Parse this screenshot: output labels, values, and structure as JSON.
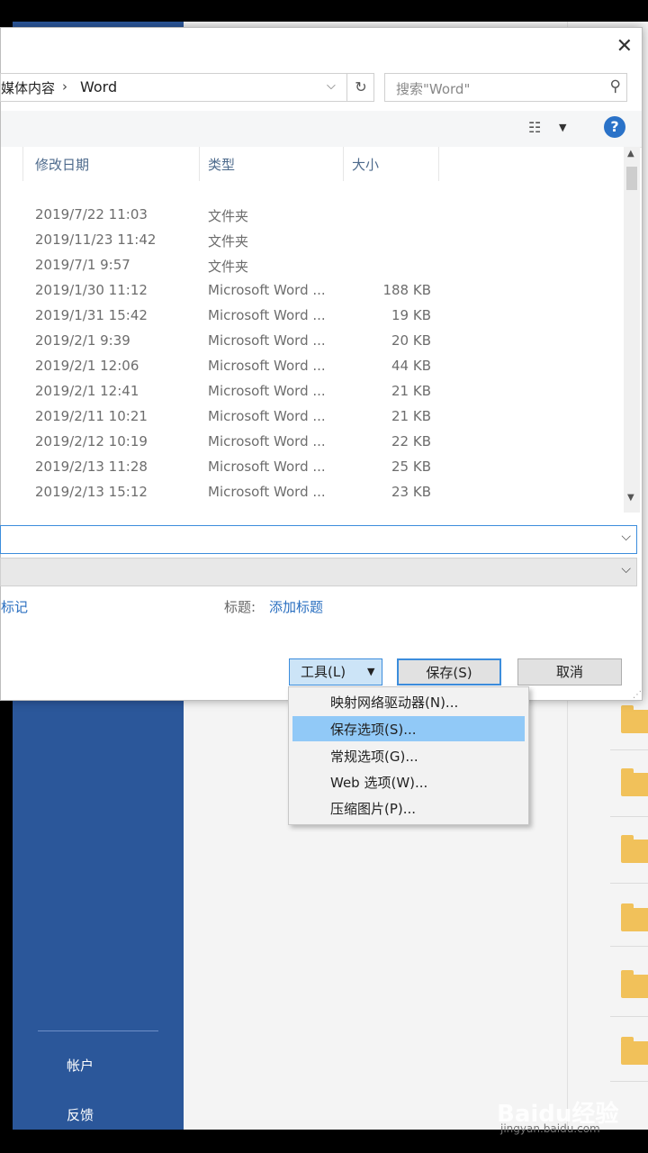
{
  "background_app": {
    "nav_account": "帐户",
    "nav_feedback": "反馈",
    "colors": {
      "backstage_blue": "#2b579a",
      "folder_yellow": "#f1c15a"
    }
  },
  "dialog": {
    "address": {
      "path_prefix": "媒体内容",
      "separator": "›",
      "current_folder": "Word"
    },
    "search": {
      "placeholder": "搜索\"Word\""
    },
    "columns": {
      "date": "修改日期",
      "type": "类型",
      "size": "大小"
    },
    "rows": [
      {
        "date": "2019/7/22 11:03",
        "type": "文件夹",
        "size": ""
      },
      {
        "date": "2019/11/23 11:42",
        "type": "文件夹",
        "size": ""
      },
      {
        "date": "2019/7/1 9:57",
        "type": "文件夹",
        "size": ""
      },
      {
        "date": "2019/1/30 11:12",
        "type": "Microsoft Word ...",
        "size": "188 KB"
      },
      {
        "date": "2019/1/31 15:42",
        "type": "Microsoft Word ...",
        "size": "19 KB"
      },
      {
        "date": "2019/2/1 9:39",
        "type": "Microsoft Word ...",
        "size": "20 KB"
      },
      {
        "date": "2019/2/1 12:06",
        "type": "Microsoft Word ...",
        "size": "44 KB"
      },
      {
        "date": "2019/2/1 12:41",
        "type": "Microsoft Word ...",
        "size": "21 KB"
      },
      {
        "date": "2019/2/11 10:21",
        "type": "Microsoft Word ...",
        "size": "21 KB"
      },
      {
        "date": "2019/2/12 10:19",
        "type": "Microsoft Word ...",
        "size": "22 KB"
      },
      {
        "date": "2019/2/13 11:28",
        "type": "Microsoft Word ...",
        "size": "25 KB"
      },
      {
        "date": "2019/2/13 15:12",
        "type": "Microsoft Word ...",
        "size": "23 KB"
      }
    ],
    "meta": {
      "tags_link": "标记",
      "title_label": "标题:",
      "title_link": "添加标题"
    },
    "buttons": {
      "tools": "工具(L)",
      "save": "保存(S)",
      "cancel": "取消"
    },
    "tools_menu": [
      {
        "label": "映射网络驱动器(N)...",
        "highlighted": false
      },
      {
        "label": "保存选项(S)...",
        "highlighted": true
      },
      {
        "label": "常规选项(G)...",
        "highlighted": false
      },
      {
        "label": "Web 选项(W)...",
        "highlighted": false
      },
      {
        "label": "压缩图片(P)...",
        "highlighted": false
      }
    ]
  },
  "watermark": {
    "logo": "Baidu经验",
    "url": "jingyan.baidu.com"
  }
}
